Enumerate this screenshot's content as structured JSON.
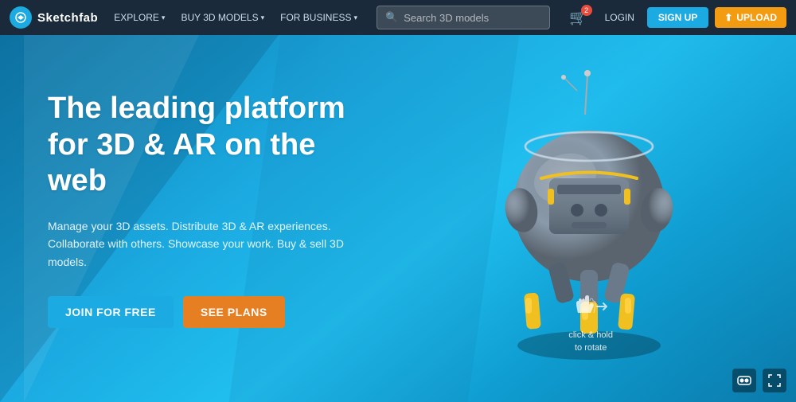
{
  "navbar": {
    "logo_text": "Sketchfab",
    "explore_label": "EXPLORE",
    "buy_models_label": "BUY 3D MODELS",
    "for_business_label": "FOR BUSINESS",
    "search_placeholder": "Search 3D models",
    "cart_badge": "2",
    "login_label": "LOGIN",
    "signup_label": "SIGN UP",
    "upload_label": "UPLOAD"
  },
  "hero": {
    "title": "The leading platform for 3D & AR on the web",
    "subtitle": "Manage your 3D assets. Distribute 3D & AR experiences. Collaborate with others. Showcase your work. Buy & sell 3D models.",
    "join_btn": "JOIN FOR FREE",
    "plans_btn": "SEE PLANS",
    "rotate_hint_line1": "click & hold",
    "rotate_hint_line2": "to rotate"
  },
  "bottom_icons": {
    "vr_icon": "VR",
    "fullscreen_icon": "⛶"
  },
  "colors": {
    "navbar_bg": "#1a2a3a",
    "hero_bg_start": "#1d8fbf",
    "hero_bg_end": "#25b5e8",
    "accent_blue": "#1baae1",
    "accent_orange": "#e67e22",
    "upload_orange": "#f39c12"
  }
}
